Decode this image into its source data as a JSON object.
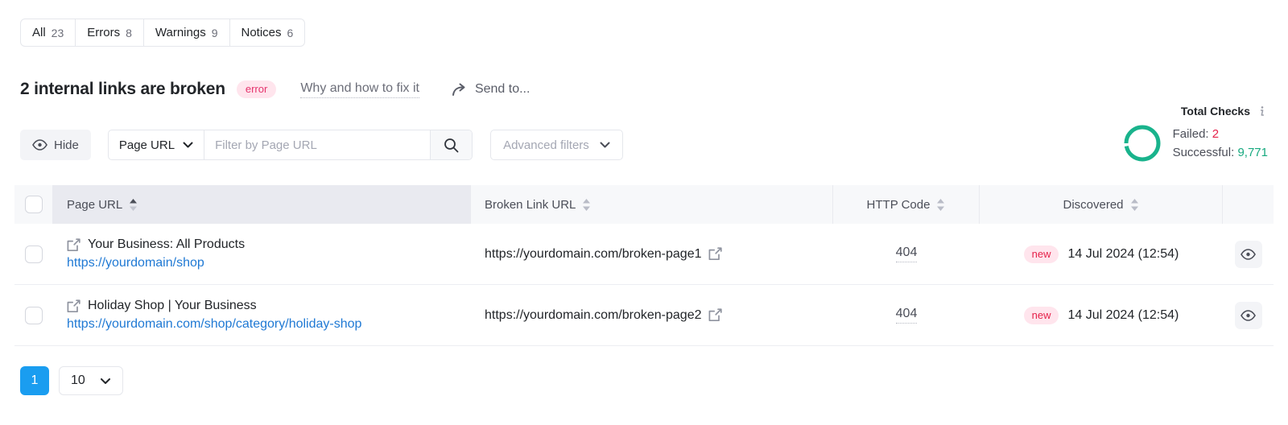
{
  "tabs": [
    {
      "label": "All",
      "count": "23"
    },
    {
      "label": "Errors",
      "count": "8"
    },
    {
      "label": "Warnings",
      "count": "9"
    },
    {
      "label": "Notices",
      "count": "6"
    }
  ],
  "heading": {
    "title": "2 internal links are broken",
    "badge": "error",
    "fix_link": "Why and how to fix it",
    "send_to": "Send to..."
  },
  "toolbar": {
    "hide_label": "Hide",
    "column_select": "Page URL",
    "filter_placeholder": "Filter by Page URL",
    "filter_value": "",
    "advanced_filters": "Advanced filters"
  },
  "checks": {
    "title": "Total Checks",
    "failed_label": "Failed:",
    "failed_value": "2",
    "successful_label": "Successful:",
    "successful_value": "9,771",
    "donut_color": "#19b38c",
    "failed_color": "#e5224a",
    "successful_color": "#17a97f"
  },
  "table": {
    "columns": [
      {
        "label": "Page URL"
      },
      {
        "label": "Broken Link URL"
      },
      {
        "label": "HTTP Code"
      },
      {
        "label": "Discovered"
      }
    ],
    "rows": [
      {
        "page_title": "Your Business: All Products",
        "page_url": "https://yourdomain/shop",
        "broken_link": "https://yourdomain.com/broken-page1",
        "http_code": "404",
        "status": "new",
        "discovered": "14 Jul 2024 (12:54)"
      },
      {
        "page_title": "Holiday Shop | Your Business",
        "page_url": "https://yourdomain.com/shop/category/holiday-shop",
        "broken_link": "https://yourdomain.com/broken-page2",
        "http_code": "404",
        "status": "new",
        "discovered": "14 Jul 2024 (12:54)"
      }
    ]
  },
  "footer": {
    "current_page": "1",
    "page_size": "10"
  }
}
